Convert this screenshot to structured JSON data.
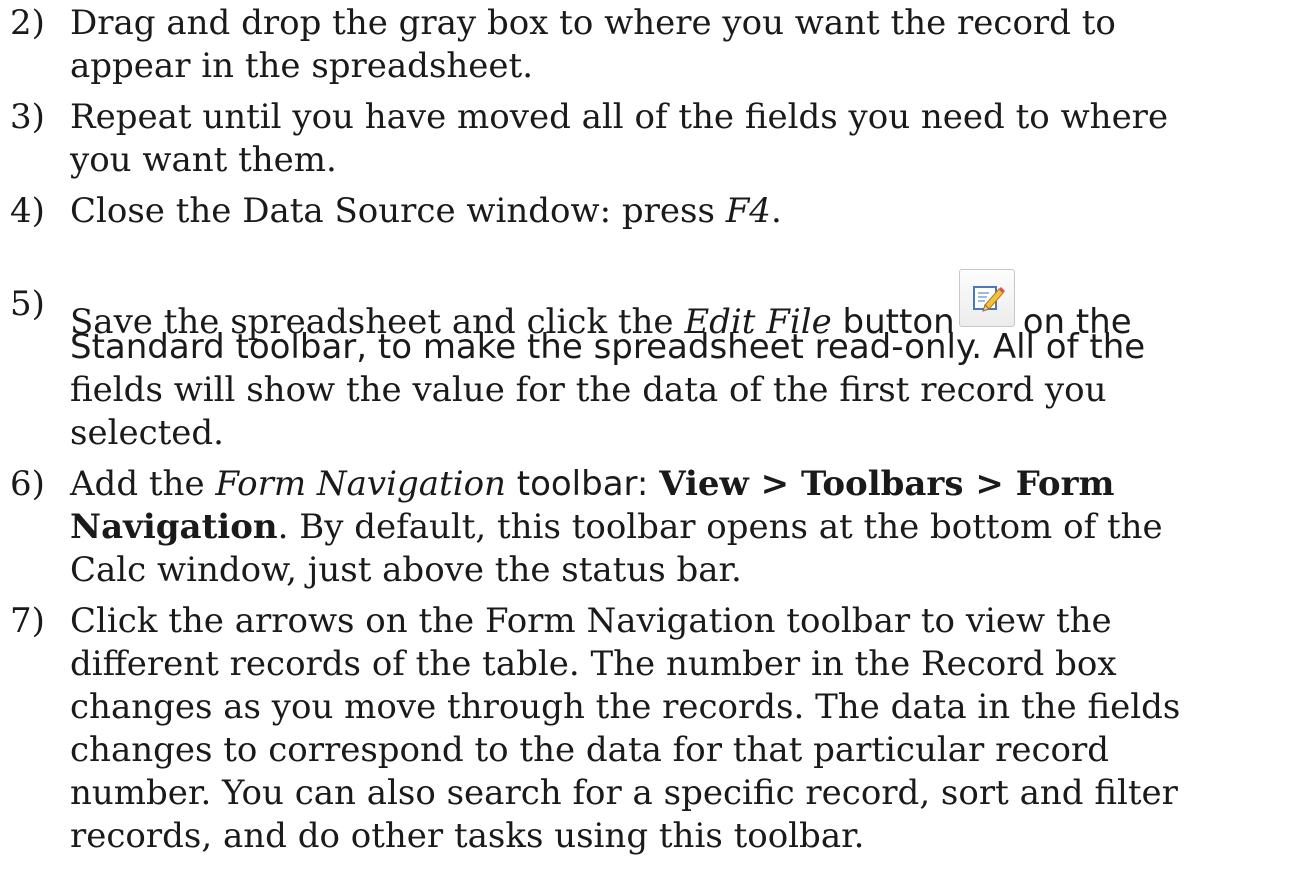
{
  "steps": [
    {
      "number": "2)",
      "lines": [
        "Drag and drop the gray box to where you want the record to",
        "appear in the spreadsheet."
      ]
    },
    {
      "number": "3)",
      "lines": [
        "Repeat until you have moved all of the fields you need to where",
        "you want them."
      ]
    },
    {
      "number": "4)",
      "pre": "Close the Data Source window: press ",
      "key": "F4",
      "post": "."
    },
    {
      "number": "5)",
      "line1_pre": "Save the spreadsheet and click the ",
      "button_name": "Edit File",
      "line1_mid": " button",
      "line1_post": "on the",
      "button_icon": "edit-file-icon",
      "lines": [
        "Standard toolbar, to make the spreadsheet read-only. All of the",
        "fields will show the value for the data of the first record you",
        "selected."
      ]
    },
    {
      "number": "6)",
      "line1_pre": "Add the ",
      "toolbar_name": "Form Navigation",
      "line1_mid": " toolbar: ",
      "menu_path_1": "View > Toolbars > Form",
      "menu_path_2": "Navigation",
      "line2_post": ". By default, this toolbar opens at the bottom of the",
      "lines": [
        "Calc window, just above the status bar."
      ]
    },
    {
      "number": "7)",
      "lines": [
        "Click the arrows on the Form Navigation toolbar to view the",
        "different records of the table. The number in the Record box",
        "changes as you move through the records. The data in the fields",
        "changes to correspond to the data for that particular record",
        "number. You can also search for a specific record, sort and filter",
        "records, and do other tasks using this toolbar."
      ]
    }
  ]
}
